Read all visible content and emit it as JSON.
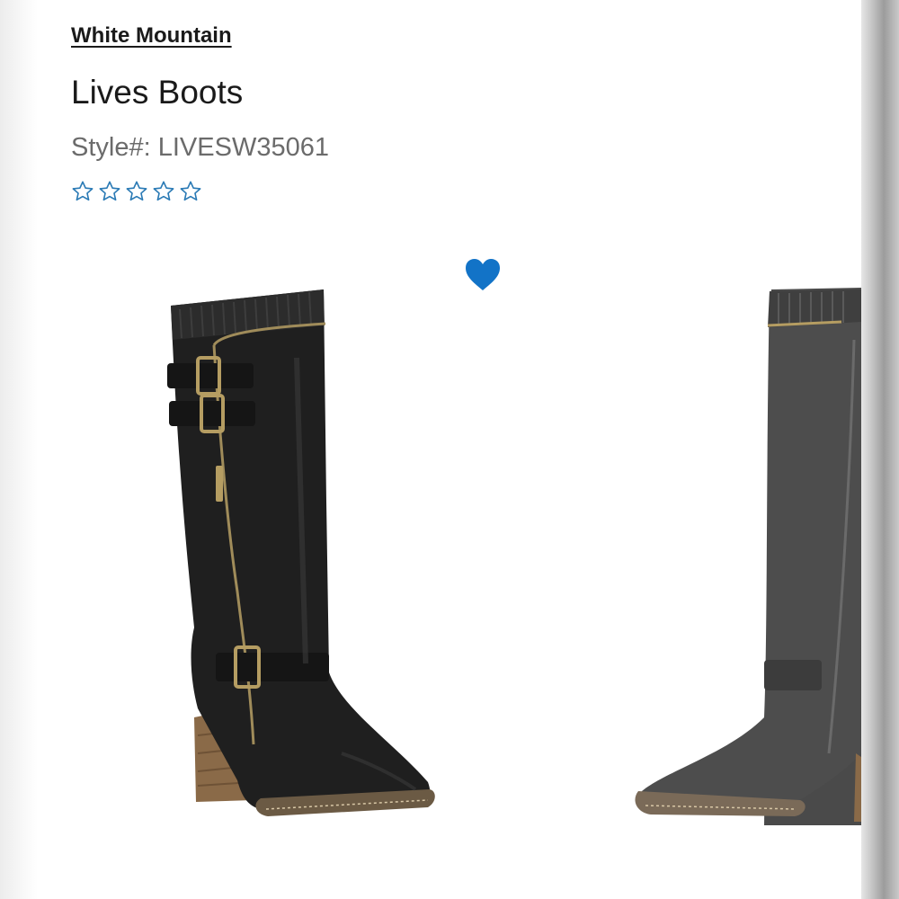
{
  "product": {
    "brand": "White Mountain",
    "name": "Lives Boots",
    "style_label": "Style#:",
    "style_number": "LIVESW35061",
    "rating": {
      "max_stars": 5,
      "filled_stars": 0,
      "icon": "star-outline-icon",
      "color": "#2a7ab5"
    }
  },
  "favorite": {
    "icon": "heart-icon",
    "color": "#1273c7"
  },
  "images": [
    {
      "name": "boot-black-main",
      "color": "#1f1f1f"
    },
    {
      "name": "boot-gray-alternate",
      "color": "#4c4c4c"
    }
  ]
}
